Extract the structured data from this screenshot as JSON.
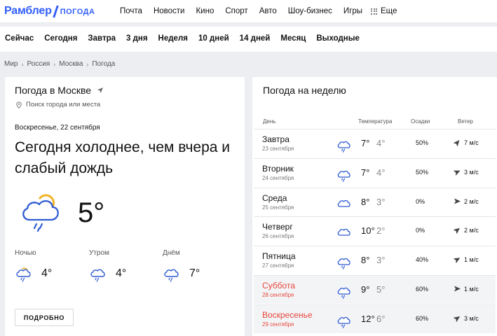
{
  "logo": {
    "brand": "Рамблер",
    "product": "погода"
  },
  "top_nav": [
    "Почта",
    "Новости",
    "Кино",
    "Спорт",
    "Авто",
    "Шоу-бизнес",
    "Игры"
  ],
  "more_label": "Еще",
  "sub_nav": [
    "Сейчас",
    "Сегодня",
    "Завтра",
    "3 дня",
    "Неделя",
    "10 дней",
    "14 дней",
    "Месяц",
    "Выходные"
  ],
  "breadcrumbs": [
    "Мир",
    "Россия",
    "Москва",
    "Погода"
  ],
  "current": {
    "city_title": "Погода в Москве",
    "search_placeholder": "Поиск города или места",
    "date": "Воскресенье, 22 сентября",
    "headline": "Сегодня холоднее, чем вчера и слабый дождь",
    "temperature": "5°",
    "icon": "cloud-sun-rain-icon",
    "parts": [
      {
        "label": "Ночью",
        "temp": "4°",
        "icon": "cloud-sun-rain-icon"
      },
      {
        "label": "Утром",
        "temp": "4°",
        "icon": "cloud-rain-icon"
      },
      {
        "label": "Днём",
        "temp": "7°",
        "icon": "cloud-rain-icon"
      }
    ],
    "details_button": "ПОДРОБНО"
  },
  "week": {
    "title": "Погода на неделю",
    "headers": {
      "day": "День",
      "temperature": "Температура",
      "precip": "Осадки",
      "wind": "Ветер"
    },
    "rows": [
      {
        "day": "Завтра",
        "date": "23 сентября",
        "day_temp": "7°",
        "night_temp": "4°",
        "precip": "50%",
        "wind": "7 м/с",
        "icon": "cloud-rain-icon",
        "weekend": false
      },
      {
        "day": "Вторник",
        "date": "24 сентября",
        "day_temp": "7°",
        "night_temp": "4°",
        "precip": "50%",
        "wind": "3 м/с",
        "icon": "cloud-rain-icon",
        "weekend": false
      },
      {
        "day": "Среда",
        "date": "25 сентября",
        "day_temp": "8°",
        "night_temp": "3°",
        "precip": "0%",
        "wind": "2 м/с",
        "icon": "cloud-icon",
        "weekend": false
      },
      {
        "day": "Четверг",
        "date": "26 сентября",
        "day_temp": "10°",
        "night_temp": "2°",
        "precip": "0%",
        "wind": "2 м/с",
        "icon": "cloud-icon",
        "weekend": false
      },
      {
        "day": "Пятница",
        "date": "27 сентября",
        "day_temp": "8°",
        "night_temp": "3°",
        "precip": "40%",
        "wind": "1 м/с",
        "icon": "cloud-rain-icon",
        "weekend": false
      },
      {
        "day": "Суббота",
        "date": "28 сентября",
        "day_temp": "9°",
        "night_temp": "5°",
        "precip": "60%",
        "wind": "1 м/с",
        "icon": "cloud-rain-icon",
        "weekend": true
      },
      {
        "day": "Воскресенье",
        "date": "29 сентября",
        "day_temp": "12°",
        "night_temp": "6°",
        "precip": "60%",
        "wind": "3 м/с",
        "icon": "cloud-rain-icon",
        "weekend": true
      }
    ]
  },
  "colors": {
    "brand": "#315efb",
    "weekend": "#e8463c",
    "icon": "#2f5bd3",
    "sun": "#f2b325"
  }
}
